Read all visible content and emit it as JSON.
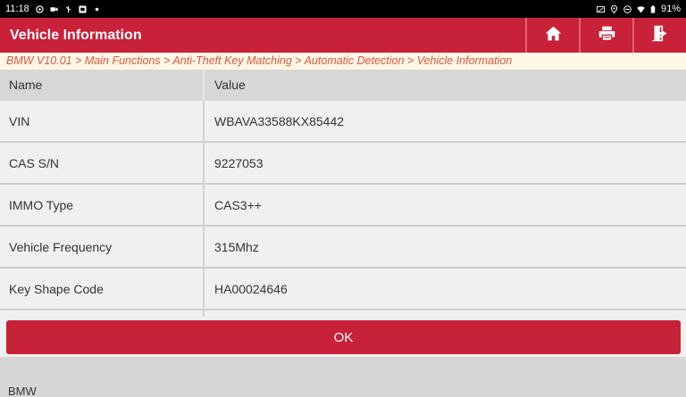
{
  "status_bar": {
    "time": "11:18",
    "battery": "91%",
    "notification_icons": [
      "media-icon",
      "video-icon",
      "usb-icon",
      "app-icon",
      "dot-icon"
    ],
    "system_icons": [
      "cast-icon",
      "location-icon",
      "dnd-icon",
      "wifi-icon",
      "battery-icon"
    ]
  },
  "header": {
    "title": "Vehicle Information",
    "buttons": [
      "home-icon",
      "print-icon",
      "exit-icon"
    ]
  },
  "breadcrumb": "BMW V10.01 > Main Functions  > Anti-Theft Key Matching > Automatic Detection > Vehicle Information",
  "table": {
    "columns": [
      "Name",
      "Value"
    ],
    "rows": [
      {
        "name": "VIN",
        "value": "WBAVA33588KX85442"
      },
      {
        "name": "CAS S/N",
        "value": "9227053"
      },
      {
        "name": "IMMO Type",
        "value": "CAS3++"
      },
      {
        "name": "Vehicle Frequency",
        "value": "315Mhz"
      },
      {
        "name": "Key Shape Code",
        "value": "HA00024646"
      }
    ]
  },
  "ok_button": "OK",
  "footer": {
    "brand": "BMW"
  },
  "colors": {
    "accent": "#c8213a",
    "breadcrumb_text": "#e0563f",
    "breadcrumb_bg": "#fff7e6"
  }
}
